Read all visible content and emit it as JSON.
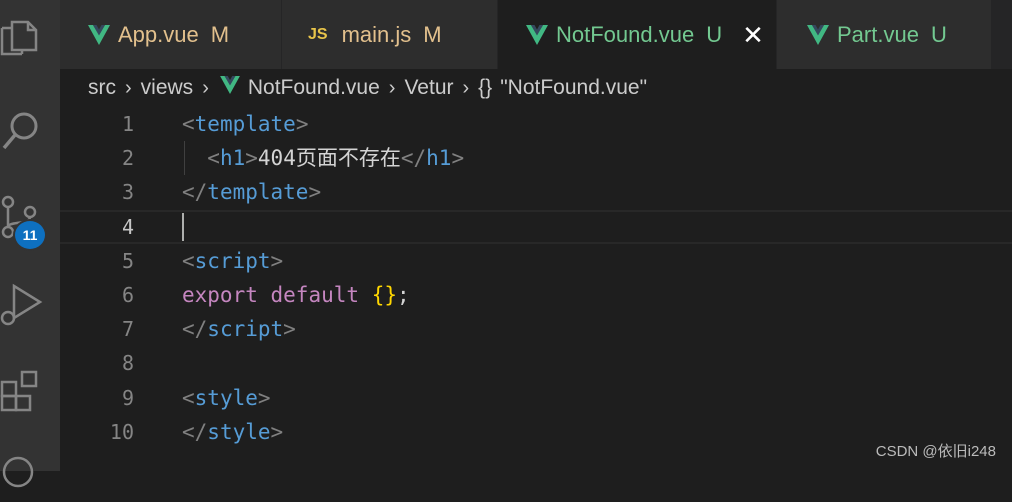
{
  "colors": {
    "vue_green": "#41b883",
    "modified": "#e2c08d",
    "untracked": "#73c991",
    "tab_text": "#e2c08d",
    "active_tab_text": "#73c991"
  },
  "activity_bar": {
    "icons": [
      "files-icon",
      "search-icon",
      "source-control-icon",
      "run-debug-icon",
      "extensions-icon",
      "account-icon"
    ],
    "source_control_badge": "11"
  },
  "tabs": [
    {
      "label": "App.vue",
      "status": "M",
      "icon": "vue-icon"
    },
    {
      "label": "main.js",
      "status": "M",
      "icon": "js-icon",
      "icon_text": "JS"
    },
    {
      "label": "NotFound.vue",
      "status": "U",
      "icon": "vue-icon",
      "active": true,
      "close": "✕"
    },
    {
      "label": "Part.vue",
      "status": "U",
      "icon": "vue-icon"
    }
  ],
  "breadcrumb": {
    "items": [
      "src",
      "views",
      "NotFound.vue",
      "Vetur"
    ],
    "symbol": "\"NotFound.vue\"",
    "braces": "{}"
  },
  "editor": {
    "current_line": 4,
    "lines": [
      {
        "n": "1"
      },
      {
        "n": "2"
      },
      {
        "n": "3"
      },
      {
        "n": "4"
      },
      {
        "n": "5"
      },
      {
        "n": "6"
      },
      {
        "n": "7"
      },
      {
        "n": "8"
      },
      {
        "n": "9"
      },
      {
        "n": "10"
      }
    ],
    "tokens": {
      "lt": "<",
      "lt_slash": "</",
      "gt": ">",
      "template": "template",
      "h1": "h1",
      "h1_text": "404页面不存在",
      "script": "script",
      "export": "export",
      "default": "default",
      "braces": "{}",
      "semi": ";",
      "style": "style"
    }
  },
  "watermark": "CSDN @依旧i248"
}
